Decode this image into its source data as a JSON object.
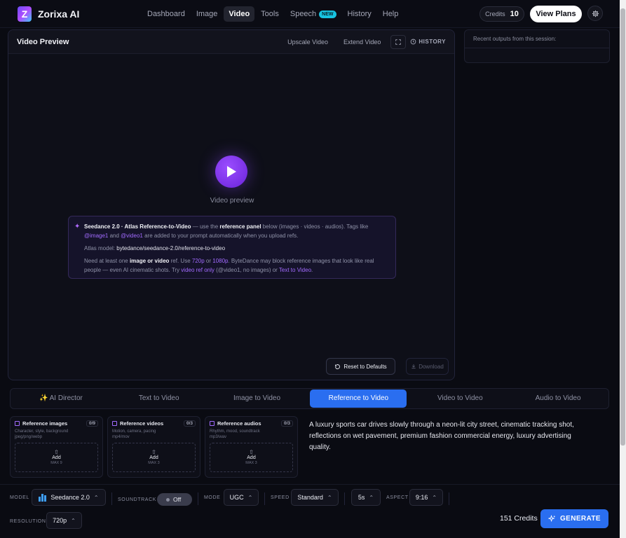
{
  "brand": {
    "logo_letter": "Z",
    "name": "Zorixa AI"
  },
  "nav": {
    "items": [
      {
        "label": "Dashboard"
      },
      {
        "label": "Image"
      },
      {
        "label": "Video"
      },
      {
        "label": "Tools"
      },
      {
        "label": "Speech",
        "badge": "NEW"
      },
      {
        "label": "History"
      },
      {
        "label": "Help"
      }
    ],
    "active": "Video",
    "credits_label": "Credits",
    "credits_value": "10",
    "plans_label": "View Plans",
    "settings_icon": "gear-icon"
  },
  "preview": {
    "title": "Video Preview",
    "upscale_label": "Upscale Video",
    "extend_label": "Extend Video",
    "history_label": "HISTORY",
    "placeholder_label": "Video preview",
    "info": {
      "title": "Seedance 2.0 · Atlas Reference-to-Video",
      "line1_a": " — use the ",
      "line1_b": "reference panel",
      "line1_c": " below (images · videos · audios). Tags like ",
      "tag_image": "@image1",
      "and": " and ",
      "tag_video": "@video1",
      "line1_d": " are added to your prompt automatically when you upload refs.",
      "model_label": "Atlas model: ",
      "model_value": "bytedance/seedance-2.0/reference-to-video",
      "need_a": "Need at least one ",
      "need_b": "image or video",
      "need_c": " ref. Use ",
      "res_720": "720p",
      "or1": " or ",
      "res_1080": "1080p",
      "need_d": ". ByteDance may block reference images that look like real people — even AI cinematic shots. Try ",
      "video_ref_only": "video ref only",
      "need_e": " (@video1, no images) or ",
      "text_to_video": "Text to Video",
      "need_f": "."
    },
    "reset_label": "Reset to Defaults",
    "download_label": "Download"
  },
  "outputs": {
    "title": "Recent outputs from this session:"
  },
  "tabs": [
    {
      "label": "✨ AI Director"
    },
    {
      "label": "Text to Video"
    },
    {
      "label": "Image to Video"
    },
    {
      "label": "Reference to Video"
    },
    {
      "label": "Video to Video"
    },
    {
      "label": "Audio to Video"
    }
  ],
  "active_tab": "Reference to Video",
  "refs": [
    {
      "title": "Reference images",
      "count": "0/9",
      "sub1": "Character, style, background",
      "sub2": "jpeg/png/webp",
      "add": "Add",
      "max": "MAX 9"
    },
    {
      "title": "Reference videos",
      "count": "0/3",
      "sub1": "Motion, camera, pacing",
      "sub2": "mp4/mov",
      "add": "Add",
      "max": "MAX 3"
    },
    {
      "title": "Reference audios",
      "count": "0/3",
      "sub1": "Rhythm, mood, soundtrack",
      "sub2": "mp3/wav",
      "add": "Add",
      "max": "MAX 3"
    }
  ],
  "prompt": "A luxury sports car drives slowly through a neon-lit city street, cinematic tracking shot, reflections on wet pavement, premium fashion commercial energy, luxury advertising quality.",
  "controls": {
    "model_label": "MODEL",
    "model_value": "Seedance 2.0",
    "soundtrack_label": "SOUNDTRACK",
    "soundtrack_value": "Off",
    "mode_label": "MODE",
    "mode_value": "UGC",
    "speed_label": "SPEED",
    "speed_value": "Standard",
    "duration_value": "5s",
    "aspect_label": "ASPECT",
    "aspect_value": "9:16",
    "resolution_label": "RESOLUTION",
    "resolution_value": "720p"
  },
  "footer": {
    "credits_total": "151 Credits",
    "generate_label": "GENERATE"
  },
  "colors": {
    "accent_blue": "#2a6ef0",
    "accent_purple": "#a26bff",
    "badge_cyan": "#17c3e0"
  }
}
